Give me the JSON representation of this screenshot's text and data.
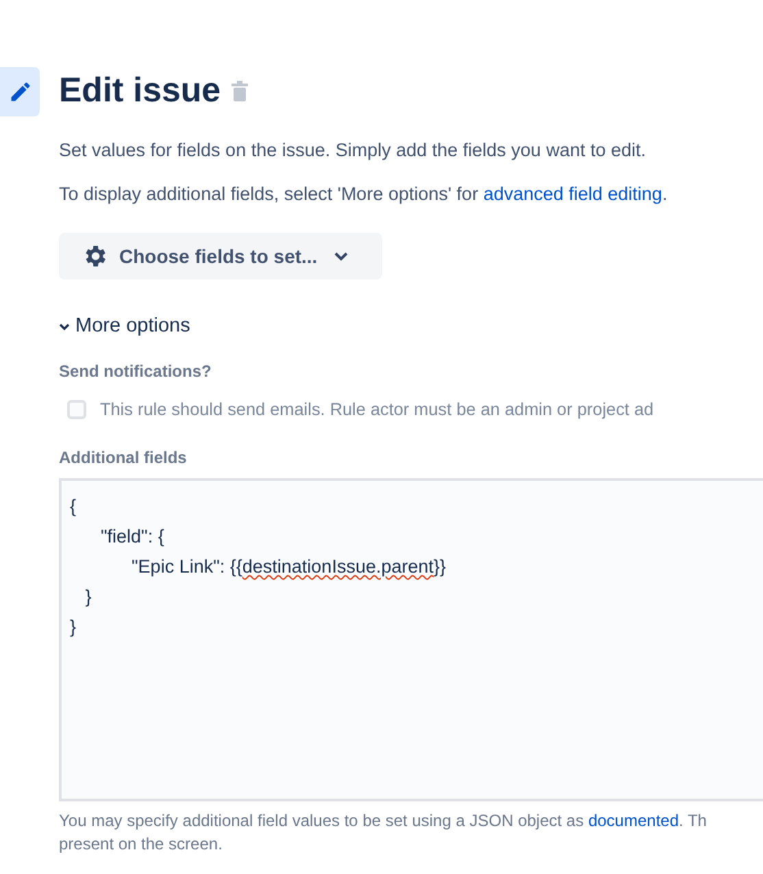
{
  "header": {
    "title": "Edit issue"
  },
  "description": "Set values for fields on the issue. Simply add the fields you want to edit.",
  "hint": {
    "before": "To display additional fields, select 'More options' for ",
    "link": "advanced field editing",
    "after": "."
  },
  "choose_button": {
    "label": "Choose fields to set..."
  },
  "more_options": {
    "label": "More options",
    "expanded": true
  },
  "notifications": {
    "label": "Send notifications?",
    "checkbox": {
      "label": "This rule should send emails. Rule actor must be an admin or project ad",
      "checked": false
    }
  },
  "additional_fields": {
    "label": "Additional fields",
    "lines": [
      {
        "text": "{"
      },
      {
        "text": "      \"field\": {"
      },
      {
        "text": "            \"Epic Link\": {{",
        "misspelled": "destinationIssue.parent",
        "after": "}}"
      },
      {
        "text": "   }"
      },
      {
        "text": "}"
      }
    ],
    "help": {
      "before": "You may specify additional field values to be set using a JSON object as ",
      "link": "documented",
      "after": ". Th",
      "line2": "present on the screen."
    }
  }
}
